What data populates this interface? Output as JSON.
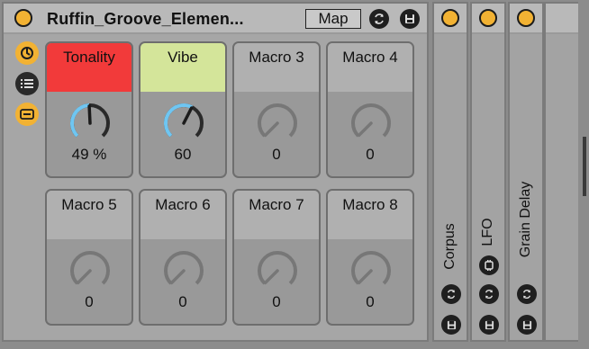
{
  "rack": {
    "title": "Ruffin_Groove_Elemen...",
    "map_label": "Map",
    "accent": "#f2b233"
  },
  "macros": [
    {
      "label": "Tonality",
      "value": "49 %",
      "level": 0.49,
      "label_bg": "#f23a3a",
      "active": true
    },
    {
      "label": "Vibe",
      "value": "60",
      "level": 0.6,
      "label_bg": "#d4e59a",
      "active": true
    },
    {
      "label": "Macro 3",
      "value": "0",
      "level": 0,
      "label_bg": "#b0b0b0",
      "active": false
    },
    {
      "label": "Macro 4",
      "value": "0",
      "level": 0,
      "label_bg": "#b0b0b0",
      "active": false
    },
    {
      "label": "Macro 5",
      "value": "0",
      "level": 0,
      "label_bg": "#b0b0b0",
      "active": false
    },
    {
      "label": "Macro 6",
      "value": "0",
      "level": 0,
      "label_bg": "#b0b0b0",
      "active": false
    },
    {
      "label": "Macro 7",
      "value": "0",
      "level": 0,
      "label_bg": "#b0b0b0",
      "active": false
    },
    {
      "label": "Macro 8",
      "value": "0",
      "level": 0,
      "label_bg": "#b0b0b0",
      "active": false
    }
  ],
  "devices": [
    {
      "name": "Corpus",
      "has_extra_button": false
    },
    {
      "name": "LFO",
      "has_extra_button": true
    },
    {
      "name": "Grain Delay",
      "has_extra_button": false
    }
  ],
  "side_icons": [
    "rack-power-icon",
    "chain-list-icon",
    "macro-toggle-icon"
  ],
  "colors": {
    "knob_arc_active": "#6fc6f2",
    "knob_arc_track": "#2a2a2a",
    "knob_inactive": "#777777"
  }
}
